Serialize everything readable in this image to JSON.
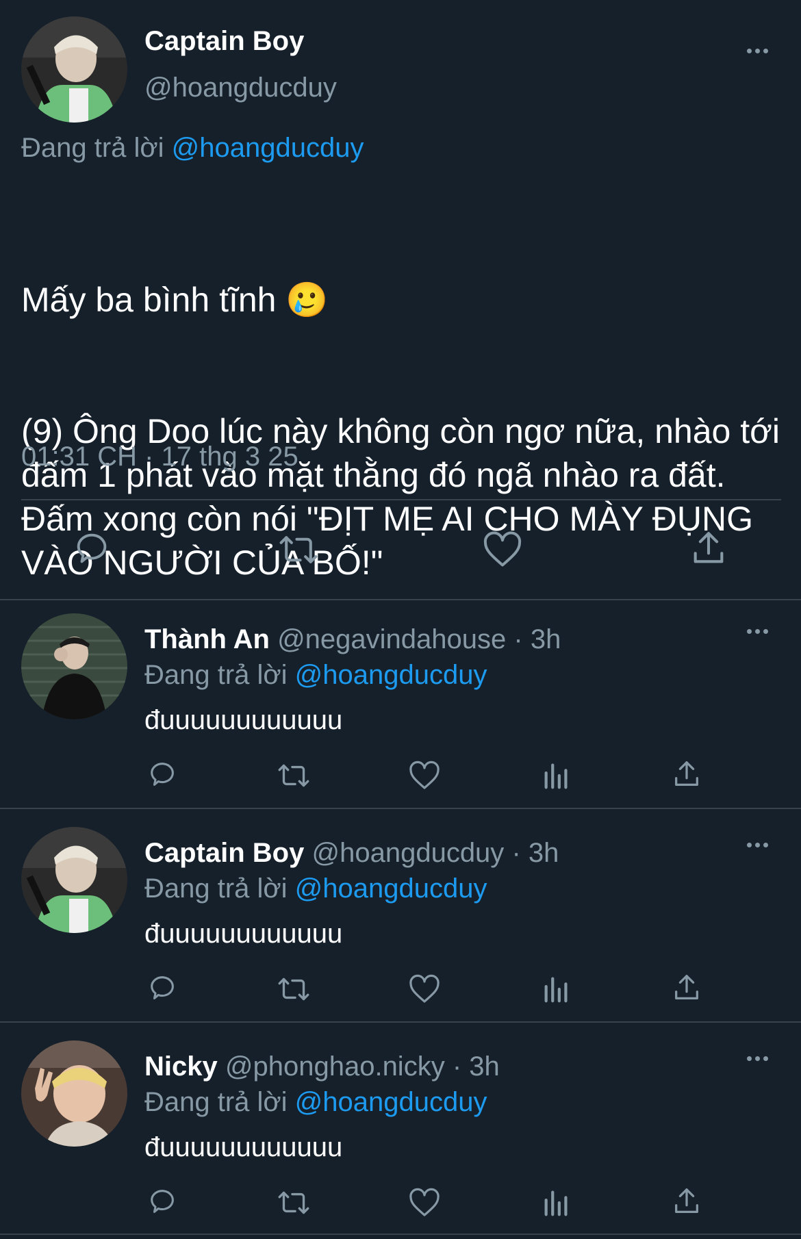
{
  "main_tweet": {
    "author_name": "Captain Boy",
    "author_handle": "@hoangducduy",
    "replying_label": "Đang trả lời",
    "replying_to": "@hoangducduy",
    "text_line1": "Mấy ba bình tĩnh 🥲",
    "text_body": "(9) Ông Doo lúc này không còn ngơ nữa, nhào tới đấm 1 phát vào mặt thằng đó ngã nhào ra đất. Đấm xong còn nói \"ĐỊT MẸ AI CHO MÀY ĐỤNG VÀO NGƯỜI CỦA BỐ!\"",
    "timestamp": "01:31 CH · 17 thg 3 25"
  },
  "replies": [
    {
      "name": "Thành An",
      "handle": "@negavindahouse",
      "time": "· 3h",
      "replying_label": "Đang trả lời",
      "replying_to": "@hoangducduy",
      "text": "đuuuuuuuuuuuu"
    },
    {
      "name": "Captain Boy",
      "handle": "@hoangducduy",
      "time": "· 3h",
      "replying_label": "Đang trả lời",
      "replying_to": "@hoangducduy",
      "text": "đuuuuuuuuuuuu"
    },
    {
      "name": "Nicky",
      "handle": "@phonghao.nicky",
      "time": "· 3h",
      "replying_label": "Đang trả lời",
      "replying_to": "@hoangducduy",
      "text": "đuuuuuuuuuuuu"
    }
  ],
  "icons": [
    "reply-icon",
    "retweet-icon",
    "like-icon",
    "analytics-icon",
    "share-icon",
    "more-icon"
  ],
  "colors": {
    "background": "#15202b",
    "text": "#ffffff",
    "muted": "#8899a6",
    "link": "#1d9bf0",
    "divider": "#38444d"
  }
}
